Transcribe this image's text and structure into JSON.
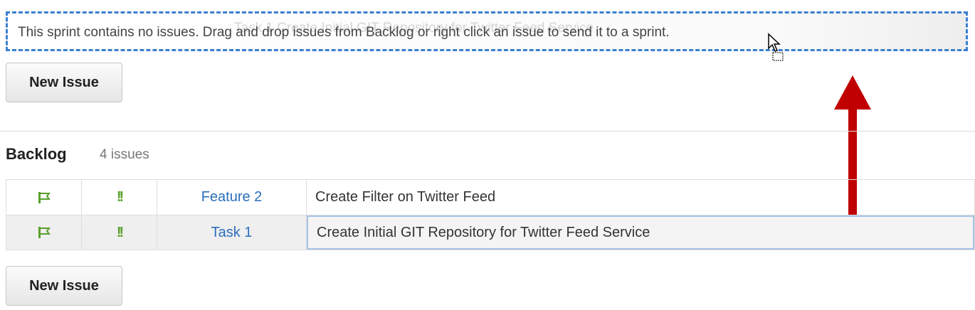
{
  "sprint": {
    "empty_message": "This sprint contains no issues. Drag and drop issues from Backlog or right click an issue to send it to a sprint.",
    "drag_ghost_text": "Task 1    Create Initial GIT Repository for Twitter Feed Service",
    "new_issue_label": "New Issue"
  },
  "backlog": {
    "title": "Backlog",
    "count": "4 issues",
    "rows": [
      {
        "type_icon": "flag-icon",
        "priority_icon": "!!",
        "key": "Feature 2",
        "summary": "Create Filter on Twitter Feed"
      },
      {
        "type_icon": "flag-icon",
        "priority_icon": "!!",
        "key": "Task 1",
        "summary": "Create Initial GIT Repository for Twitter Feed Service"
      }
    ],
    "new_issue_label": "New Issue"
  },
  "colors": {
    "dropzone_border": "#3b7fd1",
    "link": "#2a6ebb",
    "icon_green": "#5aa02c",
    "arrow_red": "#c00000"
  }
}
